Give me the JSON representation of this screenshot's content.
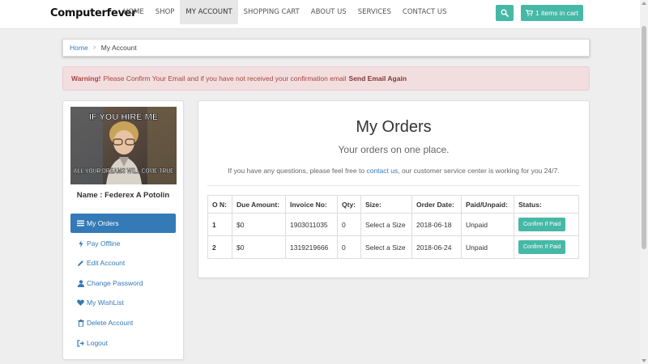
{
  "header": {
    "brand": "Computerfever",
    "nav": [
      "HOME",
      "SHOP",
      "MY ACCOUNT",
      "SHOPPING CART",
      "ABOUT US",
      "SERVICES",
      "CONTACT US"
    ],
    "active_nav": "MY ACCOUNT",
    "search_icon": "search-icon",
    "cart_label": "1 items in cart",
    "accent_color": "#46b8a6"
  },
  "breadcrumb": {
    "home": "Home",
    "separator": ">",
    "current": "My Account"
  },
  "alert": {
    "strong": "Warning!",
    "message": "Please Confirm Your Email and if you have not received your confirmation email",
    "action": "Send Email Again"
  },
  "profile": {
    "image_top_text": "IF YOU HIRE ME",
    "image_bottom_text": "ALL YOUR DREAMS WILL COME TRUE",
    "name": "Name : Federex A Potolin"
  },
  "sidebar": {
    "items": [
      {
        "label": "My Orders",
        "icon": "list-icon",
        "active": true
      },
      {
        "label": "Pay Offline",
        "icon": "bolt-icon",
        "active": false
      },
      {
        "label": "Edit Account",
        "icon": "pencil-icon",
        "active": false
      },
      {
        "label": "Change Password",
        "icon": "user-icon",
        "active": false
      },
      {
        "label": "My WishList",
        "icon": "heart-icon",
        "active": false
      },
      {
        "label": "Delete Account",
        "icon": "trash-icon",
        "active": false
      },
      {
        "label": "Logout",
        "icon": "logout-icon",
        "active": false
      }
    ]
  },
  "main": {
    "title": "My Orders",
    "subtitle": "Your orders on one place.",
    "help_prefix": "If you have any questions, please feel free to",
    "help_link": "contact us",
    "help_suffix": ", our customer service center is working for you 24/7.",
    "table": {
      "headers": [
        "O N:",
        "Due Amount:",
        "Invoice No:",
        "Qty:",
        "Size:",
        "Order Date:",
        "Paid/Unpaid:",
        "Status:"
      ],
      "rows": [
        [
          "1",
          "$0",
          "1903011035",
          "0",
          "Select a Size",
          "2018-06-18",
          "Unpaid",
          "Confirm If Paid"
        ],
        [
          "2",
          "$0",
          "1319219666",
          "0",
          "Select a Size",
          "2018-06-24",
          "Unpaid",
          "Confirm If Paid"
        ]
      ]
    }
  }
}
